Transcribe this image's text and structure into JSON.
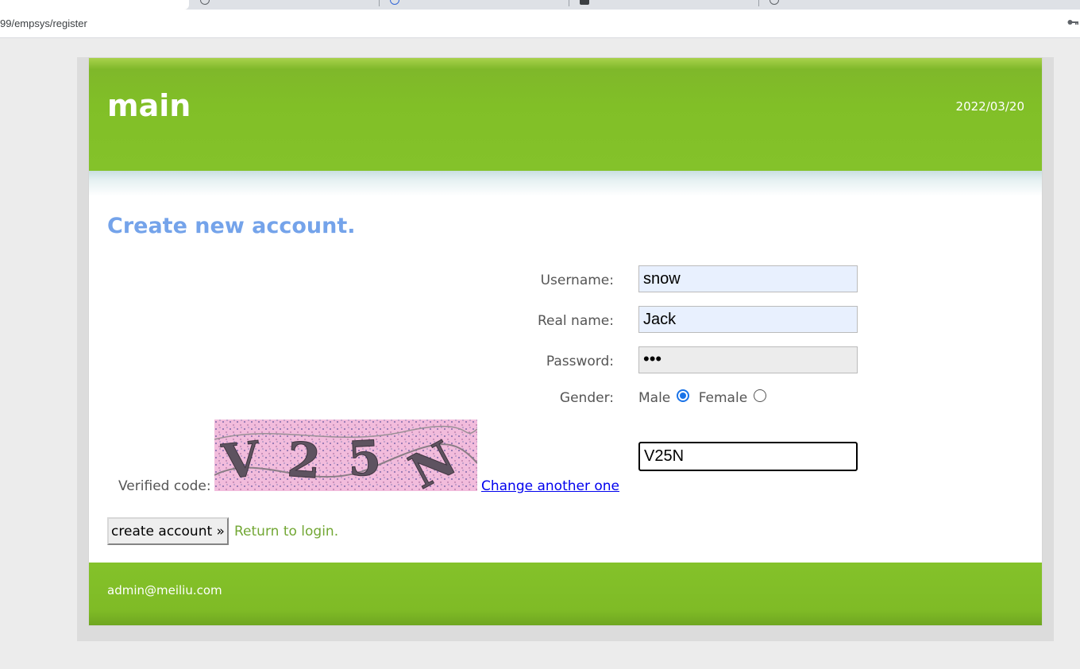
{
  "browser": {
    "url": "99/empsys/register",
    "tab_icons": [
      "globe-icon",
      "globe-icon",
      "bookmark-icon",
      "search-icon"
    ]
  },
  "header": {
    "title": "main",
    "date": "2022/03/20"
  },
  "form": {
    "heading": "Create new account.",
    "username_label": "Username:",
    "username_value": "snow",
    "realname_label": "Real name:",
    "realname_value": "Jack",
    "password_label": "Password:",
    "password_value": "•••",
    "gender_label": "Gender:",
    "gender_male": "Male",
    "gender_female": "Female",
    "gender_selected": "Male",
    "verified_label": "Verified code:",
    "captcha_text": "V25N",
    "change_link": "Change another one",
    "code_value": "V25N",
    "submit_label": "create account »",
    "return_link": "Return to login."
  },
  "footer": {
    "email": "admin@meiliu.com"
  },
  "colors": {
    "header_green": "#84c22a",
    "heading_blue": "#74a3ea",
    "link_green": "#72a734"
  }
}
